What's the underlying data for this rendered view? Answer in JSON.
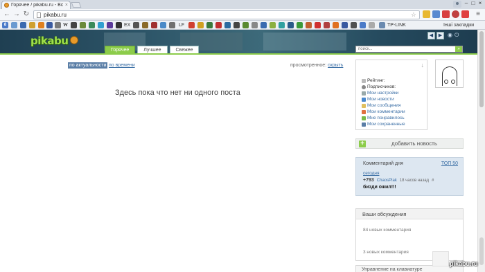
{
  "browser": {
    "tab_title": "Горячее / pikabu.ru - Все",
    "tab_close": "×",
    "url": "pikabu.ru",
    "window_controls": [
      "–",
      "□",
      "×"
    ],
    "bookmark_labels": {
      "wiki": "W",
      "ex": "EX",
      "lf": "LF",
      "tplink": "TP-LINK",
      "other": "Інші закладки"
    }
  },
  "site": {
    "logo": "pikabu",
    "tabs": [
      "Горячее",
      "Лучшее",
      "Свежее"
    ],
    "active_tab": "Горячее",
    "search_placeholder": "поиск...",
    "search_button": "»",
    "accent_color": "#8ccc4a"
  },
  "content": {
    "sort_active": "по актуальности",
    "sort_other": "по времени",
    "viewed_label": "просмотренное:",
    "viewed_action": "скрыть",
    "empty_message": "Здесь пока что нет ни одного поста"
  },
  "user_box": {
    "rating": "Рейтинг:",
    "subscribers": "Подписчиков:",
    "links": [
      "Мои настройки",
      "Мои новости",
      "Мои сообщения",
      "Мои комментарии",
      "Мне понравилось",
      "Мои сохраненные"
    ]
  },
  "add_news": "добавить новость",
  "comment_of_day": {
    "title": "Комментарий дня",
    "top": "ТОП 50",
    "today": "сегодня",
    "score": "+793",
    "author": "ChaosPlak",
    "time": "18 часов назад",
    "hash": "#",
    "text": "бизди ожил!!!"
  },
  "discussions": {
    "title": "Ваши обсуждения",
    "items": [
      "84 новых комментария",
      "3 новых комментария"
    ]
  },
  "keyboard_box": "Управление на клавиатуре",
  "watermark": "pikabu.ru"
}
